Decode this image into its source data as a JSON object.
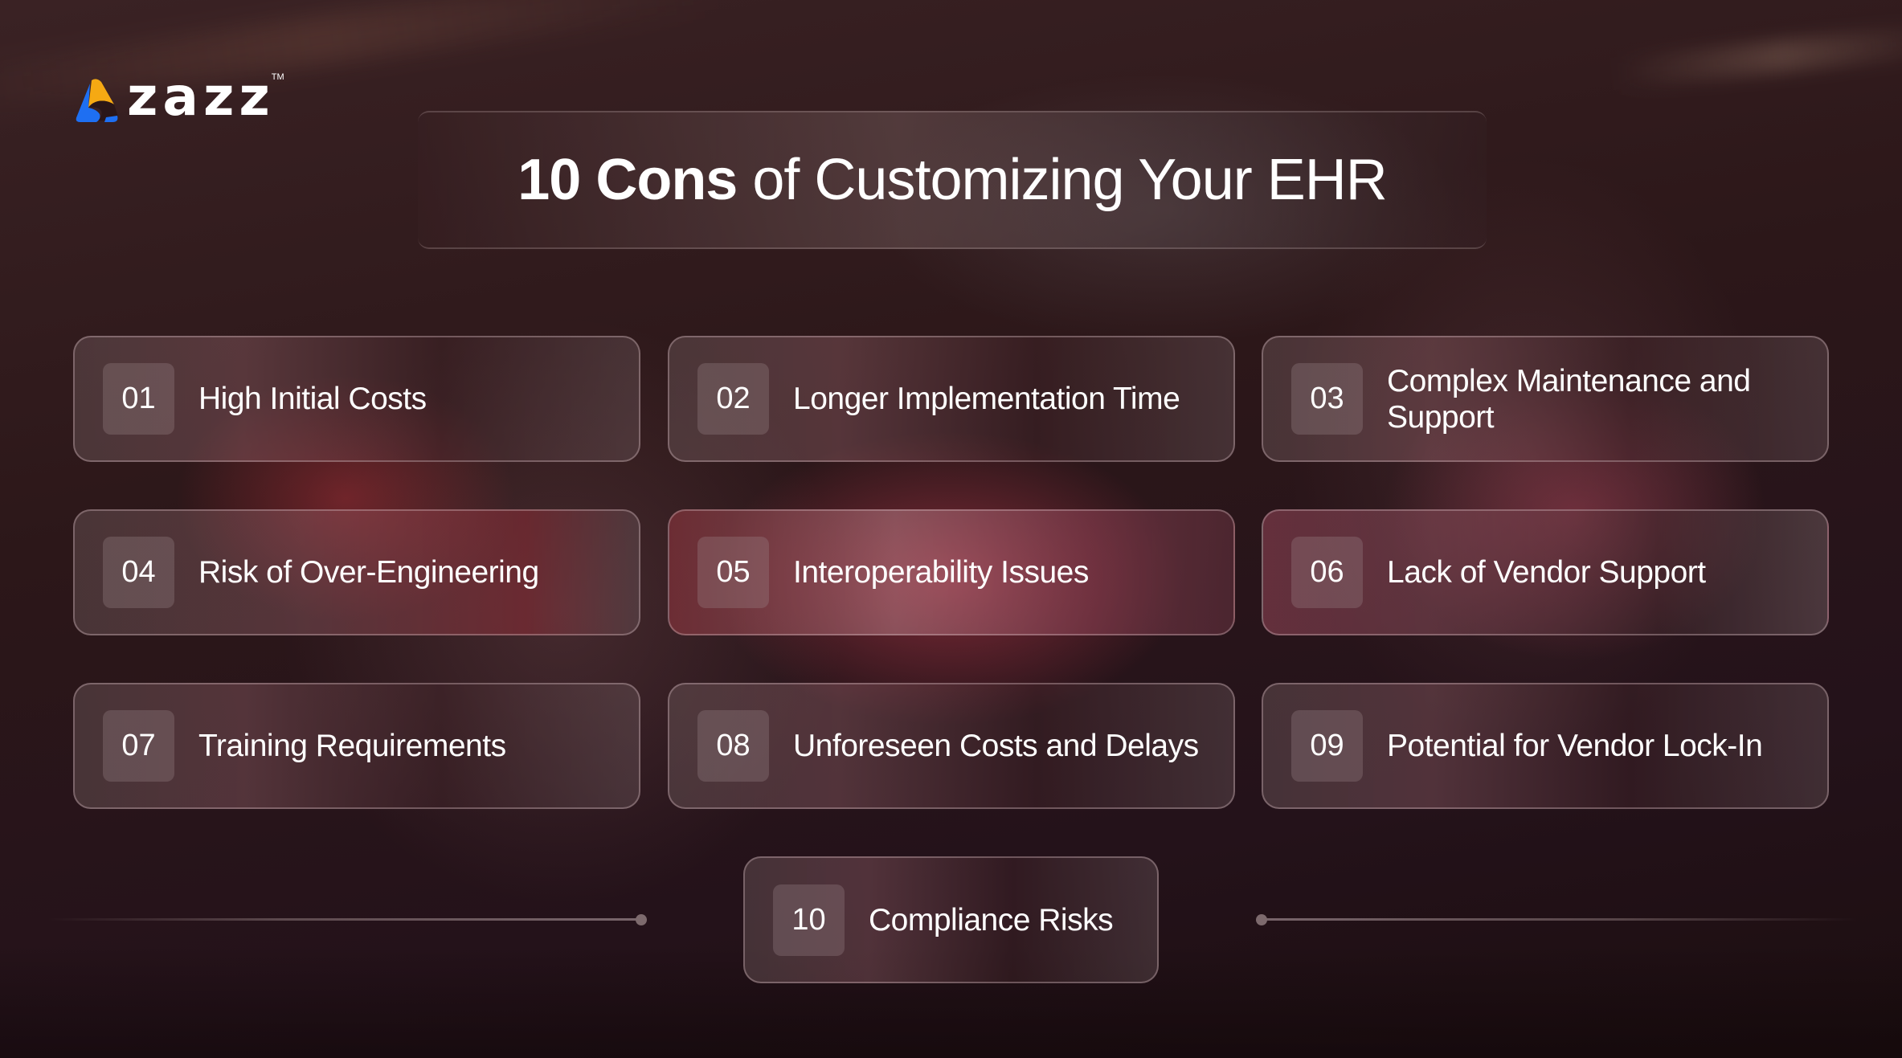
{
  "brand": {
    "name": "zazz",
    "trademark": "TM",
    "colors": {
      "yellow": "#f5a913",
      "blue": "#1e6ff2",
      "text": "#ffffff"
    }
  },
  "header": {
    "title_bold": "10 Cons",
    "title_rest": " of Customizing Your EHR"
  },
  "cons": [
    {
      "number": "01",
      "label": "High Initial Costs"
    },
    {
      "number": "02",
      "label": "Longer Implementation Time"
    },
    {
      "number": "03",
      "label": "Complex Maintenance and Support"
    },
    {
      "number": "04",
      "label": "Risk of Over-Engineering"
    },
    {
      "number": "05",
      "label": "Interoperability Issues"
    },
    {
      "number": "06",
      "label": "Lack of Vendor Support"
    },
    {
      "number": "07",
      "label": "Training Requirements"
    },
    {
      "number": "08",
      "label": "Unforeseen Costs and Delays"
    },
    {
      "number": "09",
      "label": "Potential for Vendor Lock-In"
    },
    {
      "number": "10",
      "label": "Compliance Risks"
    }
  ],
  "theme": {
    "background": "#2a1618",
    "accent_red": "#b8404f",
    "card_border": "#d2b9be"
  }
}
